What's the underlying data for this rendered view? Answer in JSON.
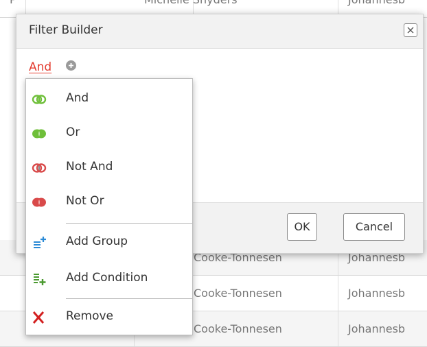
{
  "grid": {
    "rows": [
      {
        "id": "P",
        "name": "Michelle Snyders",
        "city": "Johannesb"
      },
      {
        "id": "",
        "name": "Cooke-Tonnesen",
        "city": "Johannesb"
      },
      {
        "id": "",
        "name": "Cooke-Tonnesen",
        "city": "Johannesb"
      },
      {
        "id": "",
        "name": "Cooke-Tonnesen",
        "city": "Johannesb"
      }
    ]
  },
  "dialog": {
    "title": "Filter Builder",
    "close_icon": "close-icon",
    "group_operator": "And",
    "add_icon": "plus-circle-icon",
    "ok_label": "OK",
    "cancel_label": "Cancel"
  },
  "menu": {
    "items": [
      {
        "label": "And",
        "icon": "and-group-icon"
      },
      {
        "label": "Or",
        "icon": "or-group-icon"
      },
      {
        "label": "Not And",
        "icon": "not-and-group-icon"
      },
      {
        "label": "Not Or",
        "icon": "not-or-group-icon"
      },
      {
        "label": "Add Group",
        "icon": "add-group-icon"
      },
      {
        "label": "Add Condition",
        "icon": "add-condition-icon"
      },
      {
        "label": "Remove",
        "icon": "remove-icon"
      }
    ]
  },
  "colors": {
    "operator_red": "#e33b2e",
    "and_green": "#6fbf3a",
    "not_red": "#d94a4a",
    "add_blue": "#2b8ad6"
  }
}
